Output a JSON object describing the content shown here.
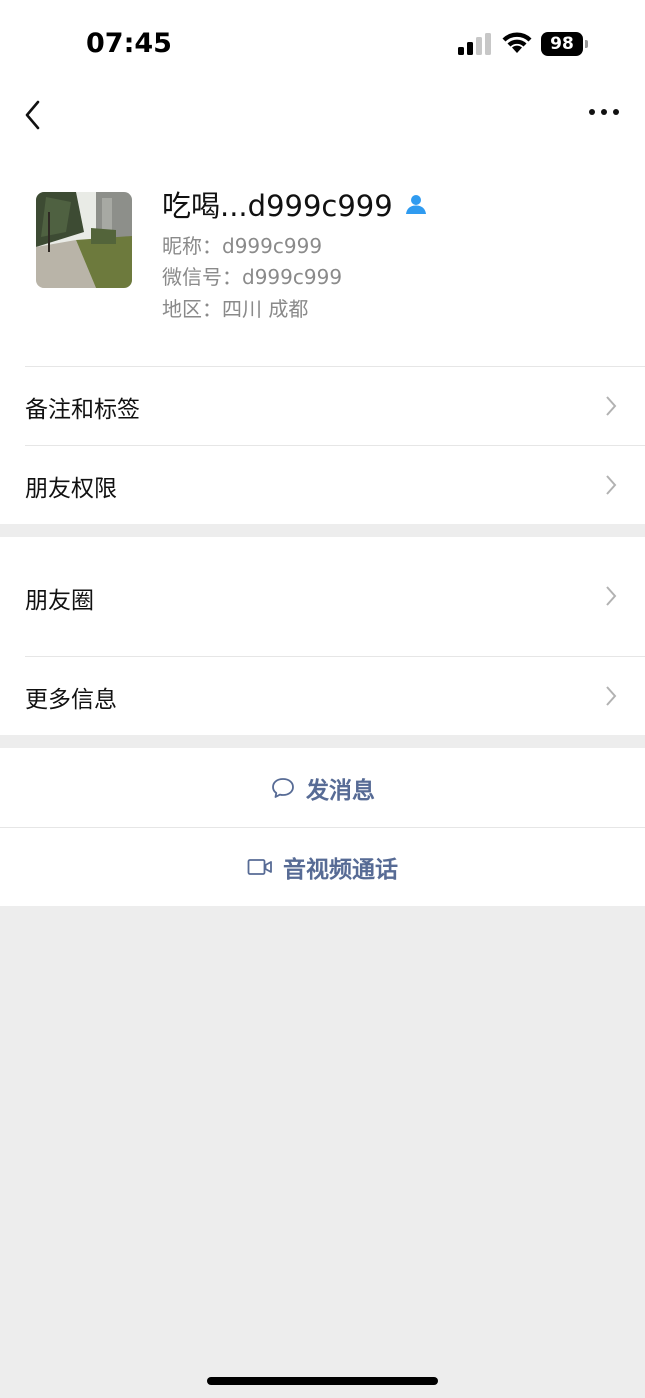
{
  "status_bar": {
    "time": "07:45",
    "battery": "98"
  },
  "nav": {
    "back_icon": "chevron-left-icon",
    "more_icon": "more-dots-icon"
  },
  "profile": {
    "display_name": "吃喝...d999c999",
    "nickname": "昵称：d999c999",
    "wechat_id": "微信号：d999c999",
    "region": "地区：四川 成都",
    "contact_icon_color": "#2f9bf0"
  },
  "rows": [
    {
      "label": "备注和标签"
    },
    {
      "label": "朋友权限"
    },
    {
      "label": "朋友圈"
    },
    {
      "label": "更多信息"
    }
  ],
  "actions": {
    "message": "发消息",
    "call": "音视频通话",
    "link_color": "#576b95"
  }
}
